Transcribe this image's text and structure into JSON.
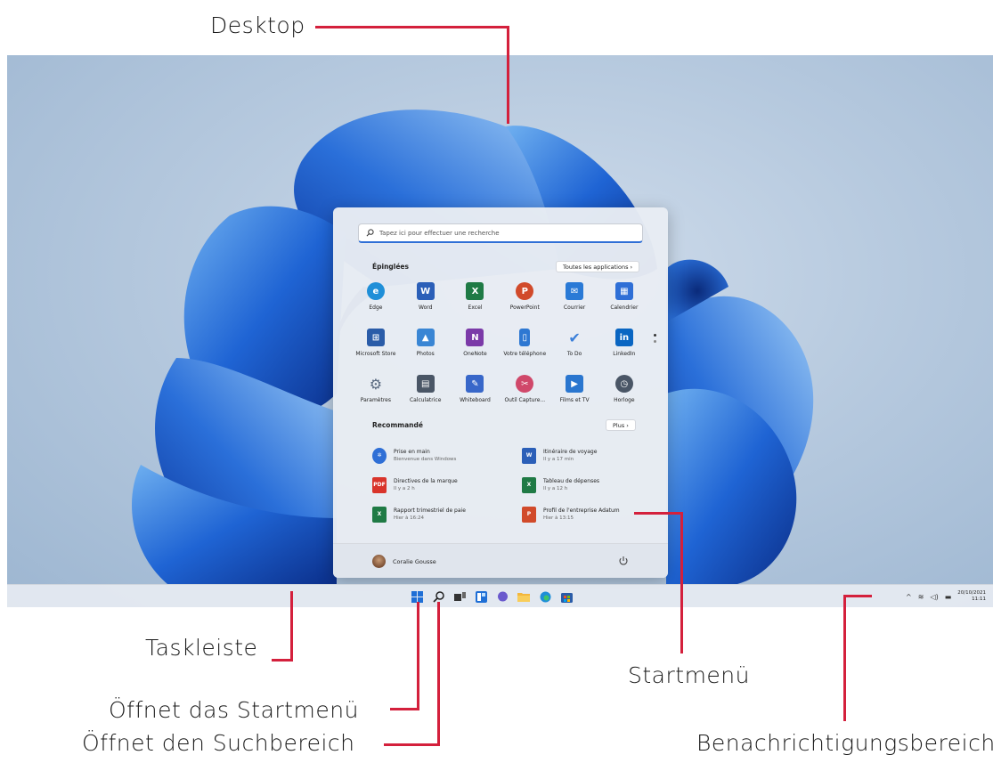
{
  "callouts": {
    "desktop": "Desktop",
    "taskbar": "Taskleiste",
    "open_start": "Öffnet das Startmenü",
    "open_search": "Öffnet den Suchbereich",
    "start_menu": "Startmenü",
    "notification_area": "Benachrichtigungsbereich"
  },
  "start_menu": {
    "search_placeholder": "Tapez ici pour effectuer une recherche",
    "pinned_title": "Épinglées",
    "all_apps_label": "Toutes les applications  ›",
    "pinned_apps": [
      {
        "label": "Edge",
        "icon": "edge-icon",
        "color": "#1f8fd8"
      },
      {
        "label": "Word",
        "icon": "word-icon",
        "color": "#2b5fb8"
      },
      {
        "label": "Excel",
        "icon": "excel-icon",
        "color": "#1f7a45"
      },
      {
        "label": "PowerPoint",
        "icon": "powerpoint-icon",
        "color": "#d14a2a"
      },
      {
        "label": "Courrier",
        "icon": "mail-icon",
        "color": "#2a7ad6"
      },
      {
        "label": "Calendrier",
        "icon": "calendar-icon",
        "color": "#2f6fd6"
      },
      {
        "label": "Microsoft Store",
        "icon": "store-icon",
        "color": "#2a5ca8"
      },
      {
        "label": "Photos",
        "icon": "photos-icon",
        "color": "#3a86d4"
      },
      {
        "label": "OneNote",
        "icon": "onenote-icon",
        "color": "#7b3aa8"
      },
      {
        "label": "Votre téléphone",
        "icon": "phone-icon",
        "color": "#2e78d2"
      },
      {
        "label": "To Do",
        "icon": "todo-icon",
        "color": "#3a7fd9"
      },
      {
        "label": "LinkedIn",
        "icon": "linkedin-icon",
        "color": "#0a66c2"
      },
      {
        "label": "Paramètres",
        "icon": "settings-icon",
        "color": "#5a6a80"
      },
      {
        "label": "Calculatrice",
        "icon": "calculator-icon",
        "color": "#4a5666"
      },
      {
        "label": "Whiteboard",
        "icon": "whiteboard-icon",
        "color": "#3867c9"
      },
      {
        "label": "Outil Capture...",
        "icon": "snipping-tool-icon",
        "color": "#d0486a"
      },
      {
        "label": "Films et TV",
        "icon": "films-tv-icon",
        "color": "#2a76cf"
      },
      {
        "label": "Horloge",
        "icon": "clock-icon",
        "color": "#4a5666"
      }
    ],
    "recommended_title": "Recommandé",
    "more_label": "Plus  ›",
    "recommended": [
      {
        "name": "Prise en main",
        "time": "Bienvenue dans Windows",
        "icon": "get-started-icon",
        "color": "#2f6fd6"
      },
      {
        "name": "Itinéraire de voyage",
        "time": "Il y a 17 min",
        "icon": "word-icon",
        "color": "#2b5fb8"
      },
      {
        "name": "Directives de la marque",
        "time": "Il y a 2 h",
        "icon": "pdf-icon",
        "color": "#d9342b"
      },
      {
        "name": "Tableau de dépenses",
        "time": "Il y a 12 h",
        "icon": "excel-icon",
        "color": "#1f7a45"
      },
      {
        "name": "Rapport trimestriel de paie",
        "time": "Hier à 16:24",
        "icon": "excel-icon",
        "color": "#1f7a45"
      },
      {
        "name": "Profil de l'entreprise Adatum",
        "time": "Hier à 13:15",
        "icon": "powerpoint-icon",
        "color": "#d14a2a"
      }
    ],
    "user_name": "Coralie Gousse"
  },
  "taskbar": {
    "icons": [
      "start-icon",
      "search-icon",
      "task-view-icon",
      "widgets-icon",
      "chat-icon",
      "file-explorer-icon",
      "edge-icon",
      "store-icon"
    ],
    "date": "20/10/2021",
    "time": "11:11"
  },
  "colors": {
    "accent": "#2f6fd6",
    "callout_line": "#d4203c"
  }
}
